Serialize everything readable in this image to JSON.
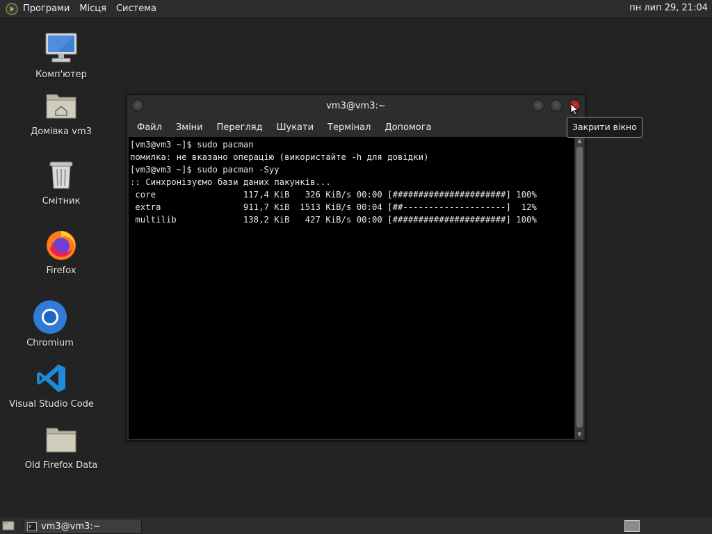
{
  "top_panel": {
    "menus": [
      "Програми",
      "Місця",
      "Система"
    ],
    "clock": "пн лип 29, 21:04"
  },
  "desktop": {
    "icons": [
      {
        "label": "Комп'ютер",
        "icon": "computer-icon"
      },
      {
        "label": "Домівка vm3",
        "icon": "home-folder-icon"
      },
      {
        "label": "Смітник",
        "icon": "trash-icon"
      },
      {
        "label": "Firefox",
        "icon": "firefox-icon"
      },
      {
        "label": "Chromium",
        "icon": "chromium-icon"
      },
      {
        "label": "Visual Studio Code",
        "icon": "vscode-icon"
      },
      {
        "label": "Old Firefox Data",
        "icon": "folder-icon"
      }
    ]
  },
  "terminal": {
    "title": "vm3@vm3:~",
    "menu": [
      "Файл",
      "Зміни",
      "Перегляд",
      "Шукати",
      "Термінал",
      "Допомога"
    ],
    "lines": [
      "[vm3@vm3 ~]$ sudo pacman",
      "помилка: не вказано операцію (використайте -h для довідки)",
      "[vm3@vm3 ~]$ sudo pacman -Syy",
      ":: Синхронізуємо бази даних пакунків...",
      " core                 117,4 KiB   326 KiB/s 00:00 [######################] 100%",
      " extra                911,7 KiB  1513 KiB/s 00:04 [##--------------------]  12%",
      " multilib             138,2 KiB   427 KiB/s 00:00 [######################] 100%"
    ]
  },
  "tooltip": "Закрити вікно",
  "taskbar": {
    "task_label": "vm3@vm3:~"
  }
}
